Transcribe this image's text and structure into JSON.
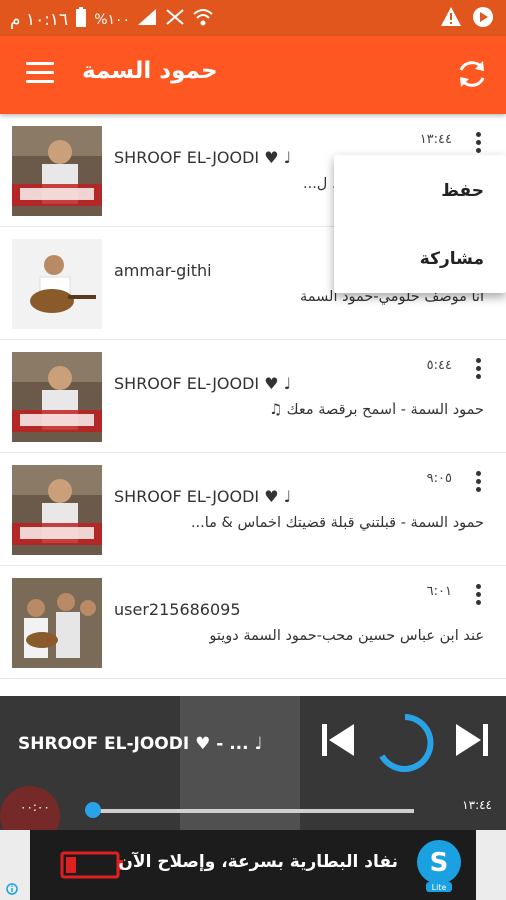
{
  "status_bar": {
    "time": "١٠:١٦ م",
    "battery": "%١٠٠"
  },
  "app_bar": {
    "title": "حمود السمة"
  },
  "tracks": [
    {
      "user": "SHROOF EL-JOODI ♥ ♩",
      "title": "نفشك | قممة الروووعة ♩ ل...",
      "duration": "١٣:٤٤"
    },
    {
      "user": "ammar-githi",
      "title": "انا موصف حلومي-حمود السمة",
      "duration": ""
    },
    {
      "user": "SHROOF EL-JOODI ♥ ♩",
      "title": "حمود السمة - أسمح برقصة معك ♫",
      "duration": "٥:٤٤"
    },
    {
      "user": "SHROOF EL-JOODI ♥ ♩",
      "title": "حمود السمة - قبلتني قبلة قضيتك اخماس & ما...",
      "duration": "٩:٠٥"
    },
    {
      "user": "user215686095",
      "title": "عند ابن عباس حسين محب-حمود السمة دويتو",
      "duration": "٦:٠١"
    }
  ],
  "popup_menu": {
    "save_label": "حفظ",
    "share_label": "مشاركة"
  },
  "player": {
    "title": "SHROOF EL-JOODI ♥ - ... ♩",
    "current_time": "٠٠:٠٠",
    "total_time": "١٣:٤٤",
    "progress": 0.0
  },
  "ad": {
    "text": "نفاد البطارية بسرعة، وإصلاح الآن",
    "logo_label": "Lite"
  },
  "colors": {
    "accent": "#ff5722",
    "progress": "#29a3e8"
  }
}
